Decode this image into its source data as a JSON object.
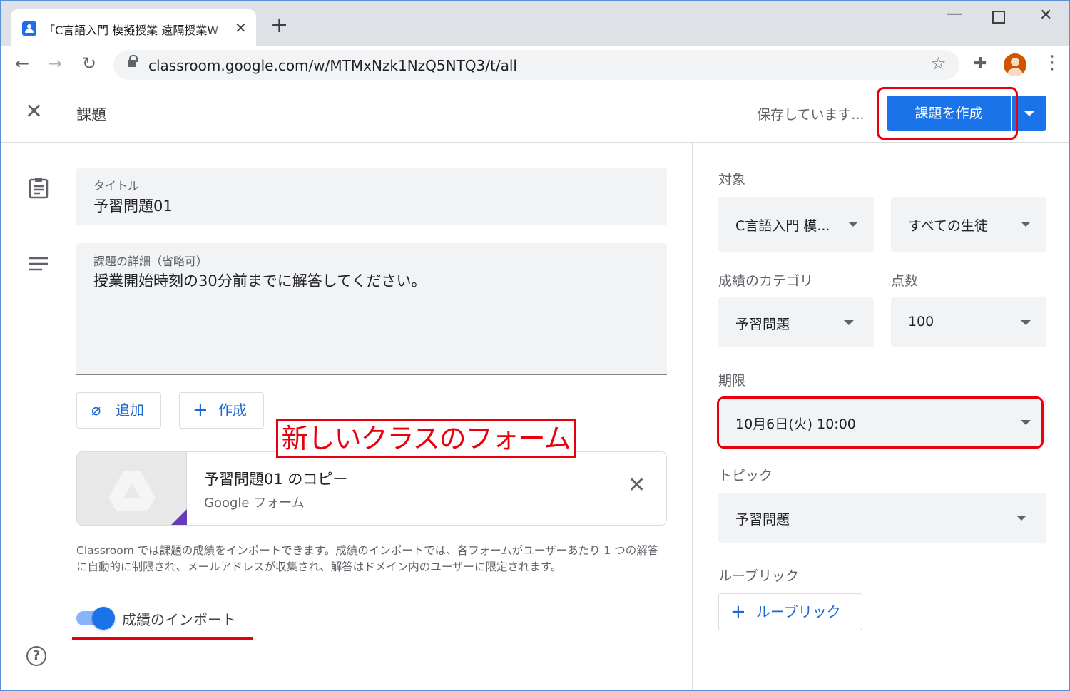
{
  "browser": {
    "tab_title": "「C言語入門 模擬授業 遠隔授業W",
    "url": "classroom.google.com/w/MTMxNzk1NzQ5NTQ3/t/all"
  },
  "header": {
    "title": "課題",
    "saving_status": "保存しています...",
    "create_button": "課題を作成"
  },
  "form": {
    "title_label": "タイトル",
    "title_value": "予習問題01",
    "details_label": "課題の詳細（省略可）",
    "details_value": "授業開始時刻の30分前までに解答してください。",
    "add_button": "追加",
    "create_button": "作成"
  },
  "annotation": {
    "callout": "新しいクラスのフォーム"
  },
  "attachment": {
    "title": "予習問題01 のコピー",
    "type": "Google フォーム"
  },
  "notice": "Classroom では課題の成績をインポートできます。成績のインポートでは、各フォームがユーザーあたり 1 つの解答に自動的に制限され、メールアドレスが収集され、解答はドメイン内のユーザーに限定されます。",
  "grade_import": {
    "label": "成績のインポート",
    "enabled": true
  },
  "sidebar": {
    "target_label": "対象",
    "class_value": "C言語入門 模...",
    "students_value": "すべての生徒",
    "grade_category_label": "成績のカテゴリ",
    "grade_category_value": "予習問題",
    "points_label": "点数",
    "points_value": "100",
    "due_label": "期限",
    "due_value": "10月6日(火) 10:00",
    "topic_label": "トピック",
    "topic_value": "予習問題",
    "rubric_label": "ルーブリック",
    "rubric_button": "ルーブリック"
  },
  "colors": {
    "accent": "#1a73e8",
    "highlight": "#e8000d",
    "form_purple": "#673ab7"
  }
}
